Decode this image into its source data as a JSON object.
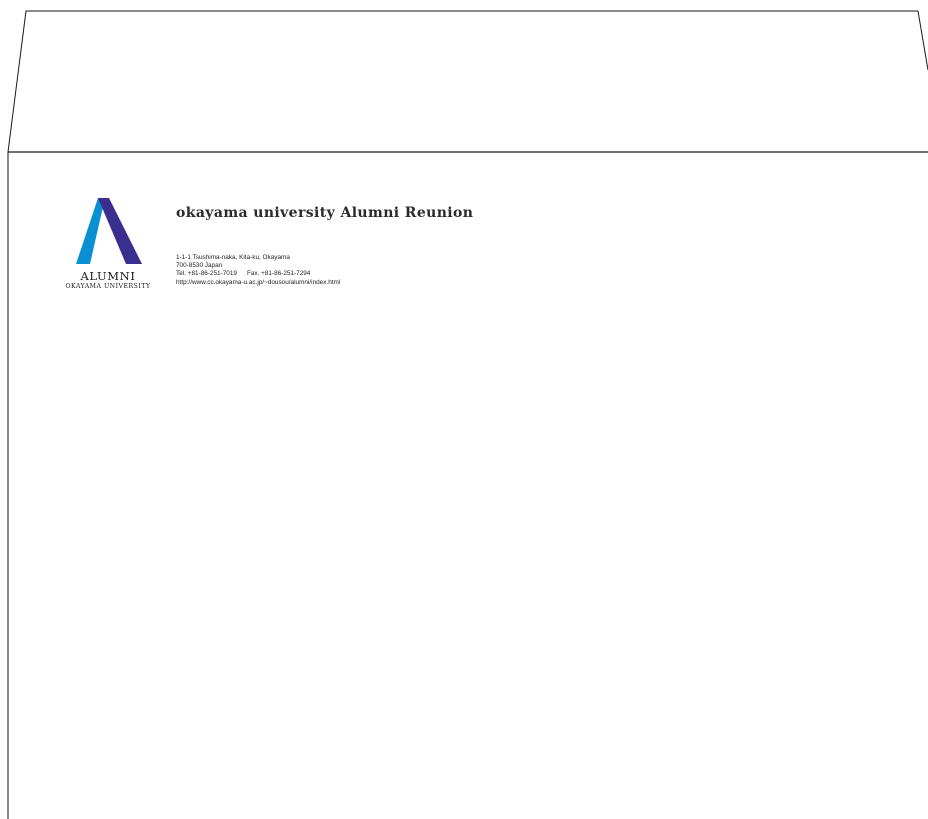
{
  "logo": {
    "icon": "alumni-a-icon",
    "wordmark": "ALUMNI",
    "subtitle": "OKAYAMA UNIVERSITY",
    "colors": {
      "left_stroke": "#0a8fd3",
      "right_stroke": "#3a2f8f"
    }
  },
  "organization": {
    "name": "okayama university Alumni Reunion"
  },
  "address": {
    "street": "1-1-1 Tsushima-naka, Kita-ku, Okayama",
    "postal": "700-8530  Japan",
    "tel": "Tel. +81-86-251-7019",
    "fax": "Fax. +81-86-251-7294",
    "url": "http://www.cc.okayama-u.ac.jp/~dousou/alumni/index.html"
  }
}
